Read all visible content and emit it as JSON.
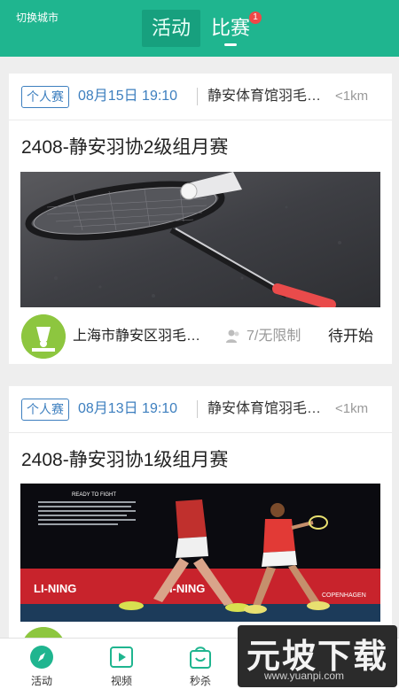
{
  "header": {
    "switch_city": "切换城市",
    "tabs": [
      {
        "label": "活动",
        "active": false
      },
      {
        "label": "比赛",
        "active": true
      }
    ],
    "match_badge": "1"
  },
  "matches": [
    {
      "type": "个人赛",
      "time": "08月15日 19:10",
      "venue": "静安体育馆羽毛…",
      "distance": "<1km",
      "title": "2408-静安羽协2级组月赛",
      "club": "上海市静安区羽毛…",
      "participants": "7/无限制",
      "status": "待开始"
    },
    {
      "type": "个人赛",
      "time": "08月13日 19:10",
      "venue": "静安体育馆羽毛…",
      "distance": "<1km",
      "title": "2408-静安羽协1级组月赛",
      "banner_heading": "READY TO FIGHT",
      "banner_boards": [
        "LI-NING",
        "LI-NING",
        "COPENHAGEN"
      ]
    }
  ],
  "bottom_nav": [
    {
      "label": "活动",
      "icon": "compass-icon",
      "active": true
    },
    {
      "label": "视频",
      "icon": "play-icon",
      "active": false
    },
    {
      "label": "秒杀",
      "icon": "shopping-bag-icon",
      "active": false
    },
    {
      "label": "",
      "icon": "user-icon",
      "active": false
    },
    {
      "label": "",
      "icon": "profile-icon",
      "active": false
    }
  ],
  "watermark": {
    "title": "元坡下载",
    "url": "www.yuanpi.com"
  },
  "colors": {
    "header": "#1fb58f",
    "accent_blue": "#3d7fbf",
    "nav_active": "#1fb58f",
    "badge": "#f04848"
  }
}
